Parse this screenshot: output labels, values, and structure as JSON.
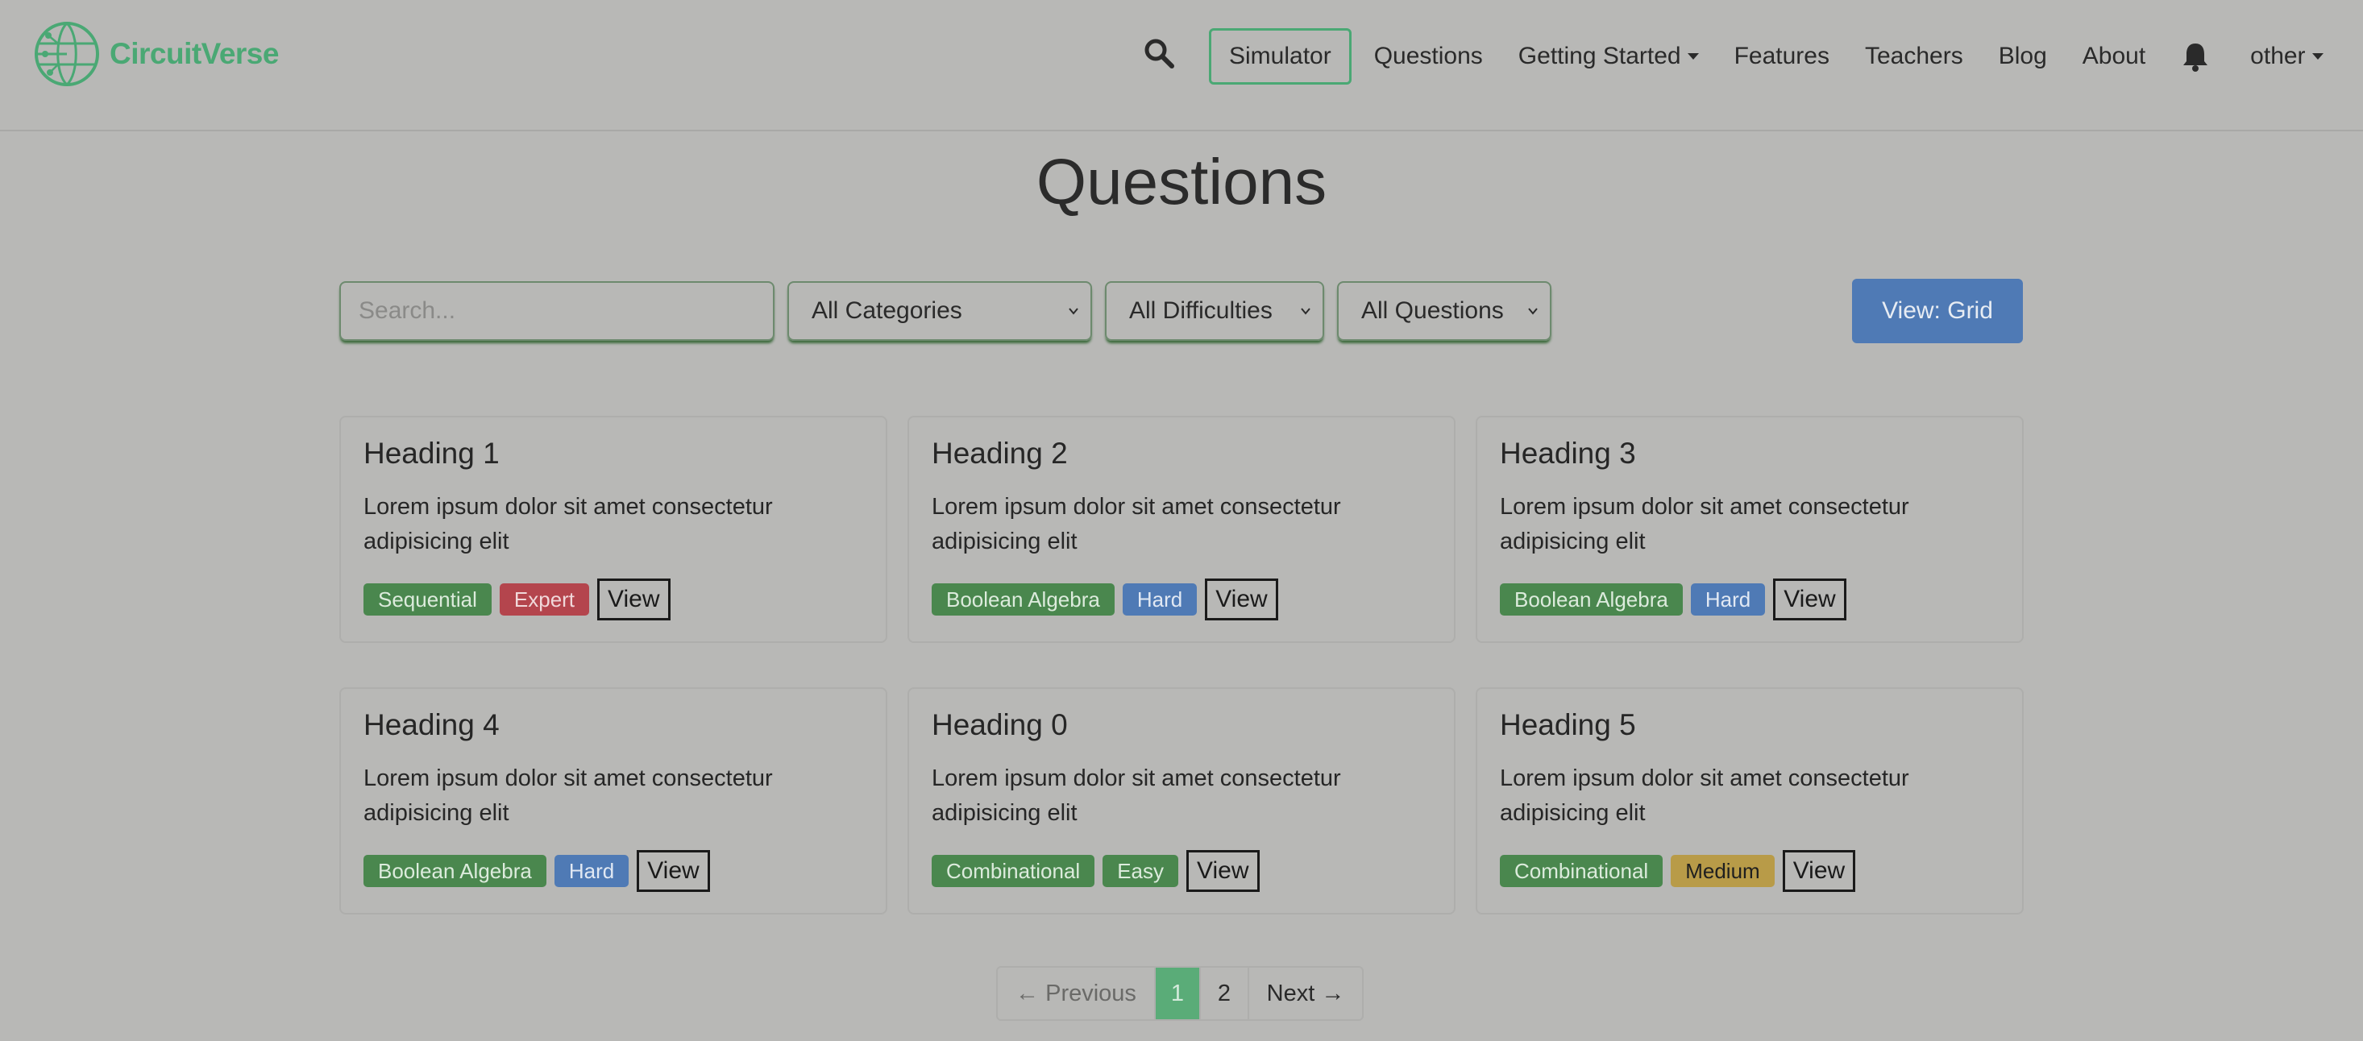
{
  "nav": {
    "brand": "CircuitVerse",
    "simulator": "Simulator",
    "questions": "Questions",
    "getting_started": "Getting Started",
    "features": "Features",
    "teachers": "Teachers",
    "blog": "Blog",
    "about": "About",
    "user": "other",
    "icons": [
      "circuitverse-logo",
      "search-icon",
      "bell-icon",
      "chevron-down-icon"
    ]
  },
  "page": {
    "title": "Questions"
  },
  "filters": {
    "search_placeholder": "Search...",
    "category": "All Categories",
    "difficulty": "All Difficulties",
    "questions": "All Questions",
    "view_button": "View: Grid"
  },
  "colors": {
    "brand": "#4aa874",
    "category_tag": "#4a874e",
    "expert": "#b4454d",
    "hard": "#4f7ab5",
    "easy": "#4a874e",
    "medium": "#b89b48",
    "view_grid_button": "#4f7ab5"
  },
  "cards": [
    {
      "heading": "Heading 1",
      "text": "Lorem ipsum dolor sit amet consectetur adipisicing elit",
      "category": "Sequential",
      "difficulty": "Expert",
      "view": "View"
    },
    {
      "heading": "Heading 2",
      "text": "Lorem ipsum dolor sit amet consectetur adipisicing elit",
      "category": "Boolean Algebra",
      "difficulty": "Hard",
      "view": "View"
    },
    {
      "heading": "Heading 3",
      "text": "Lorem ipsum dolor sit amet consectetur adipisicing elit",
      "category": "Boolean Algebra",
      "difficulty": "Hard",
      "view": "View"
    },
    {
      "heading": "Heading 4",
      "text": "Lorem ipsum dolor sit amet consectetur adipisicing elit",
      "category": "Boolean Algebra",
      "difficulty": "Hard",
      "view": "View"
    },
    {
      "heading": "Heading 0",
      "text": "Lorem ipsum dolor sit amet consectetur adipisicing elit",
      "category": "Combinational",
      "difficulty": "Easy",
      "view": "View"
    },
    {
      "heading": "Heading 5",
      "text": "Lorem ipsum dolor sit amet consectetur adipisicing elit",
      "category": "Combinational",
      "difficulty": "Medium",
      "view": "View"
    }
  ],
  "pagination": {
    "previous": "← Previous",
    "pages": [
      "1",
      "2"
    ],
    "current": "1",
    "next": "Next →"
  }
}
